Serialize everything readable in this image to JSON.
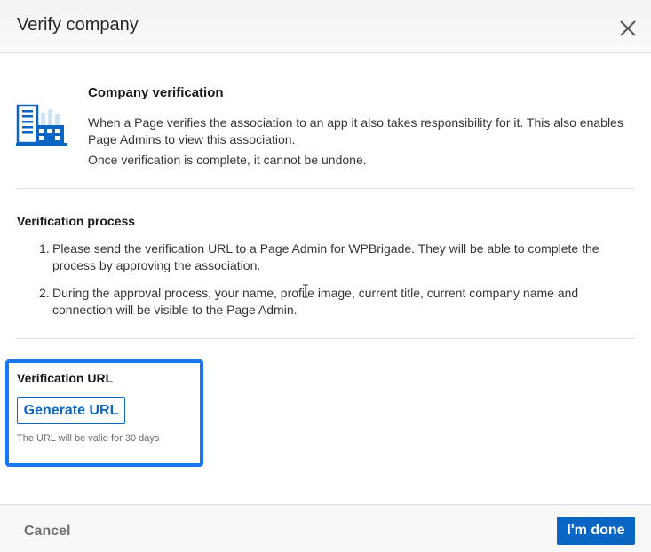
{
  "dialog": {
    "title": "Verify company",
    "close_icon": "close-icon"
  },
  "company_verification": {
    "icon": "company-building-icon",
    "heading": "Company verification",
    "paragraph_line1": "When a Page verifies the association to an app it also takes responsibility for it. This also enables",
    "paragraph_line2": "Page Admins to view this association.",
    "note": "Once verification is complete, it cannot be undone."
  },
  "verification_process": {
    "heading": "Verification process",
    "steps": [
      {
        "number": "1.",
        "line1": "Please send the verification URL to a Page Admin for WPBrigade. They will be able to complete the",
        "line2": "process by approving the association."
      },
      {
        "number": "2.",
        "line1": "During the approval process, your name, profile image, current title, current company name and",
        "line2": "connection will be visible to the Page Admin."
      }
    ]
  },
  "verification_url": {
    "heading": "Verification URL",
    "button_label": "Generate URL",
    "hint": "The URL will be valid for 30 days"
  },
  "footer": {
    "cancel_label": "Cancel",
    "done_label": "I'm done"
  },
  "colors": {
    "accent": "#0a66c2",
    "highlight": "#1877f2",
    "divider": "#e0e0e0"
  }
}
